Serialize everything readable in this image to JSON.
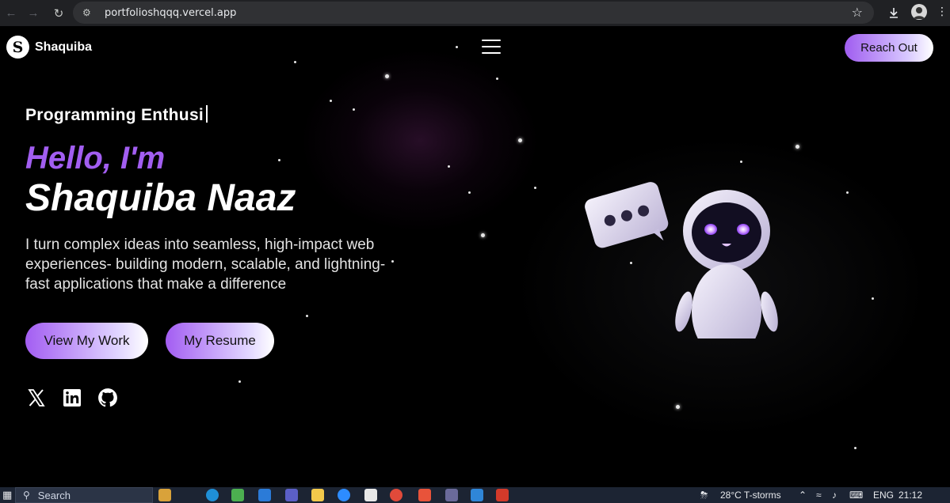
{
  "browser": {
    "url": "portfolioshqqq.vercel.app",
    "back_icon": "arrow-left-icon",
    "forward_icon": "arrow-right-icon",
    "reload_icon": "reload-icon"
  },
  "header": {
    "logo_letter": "S",
    "logo_text": "Shaquiba",
    "cta_label": "Reach Out"
  },
  "hero": {
    "typing_text": "Programming Enthusi",
    "greeting": "Hello, I'm",
    "name": "Shaquiba Naaz",
    "bio": "I turn complex ideas into seamless, high-impact web experiences- building modern, scalable, and lightning-fast applications that make a difference",
    "buttons": {
      "work": "View My Work",
      "resume": "My Resume"
    }
  },
  "social": [
    "x-icon",
    "linkedin-icon",
    "github-icon"
  ],
  "taskbar": {
    "search_label": "Search",
    "weather": "28°C  T-storms",
    "language": "ENG",
    "time": "21:12"
  },
  "colors": {
    "accent": "#a25ef1",
    "background": "#000000",
    "taskbar": "#1c2433"
  }
}
